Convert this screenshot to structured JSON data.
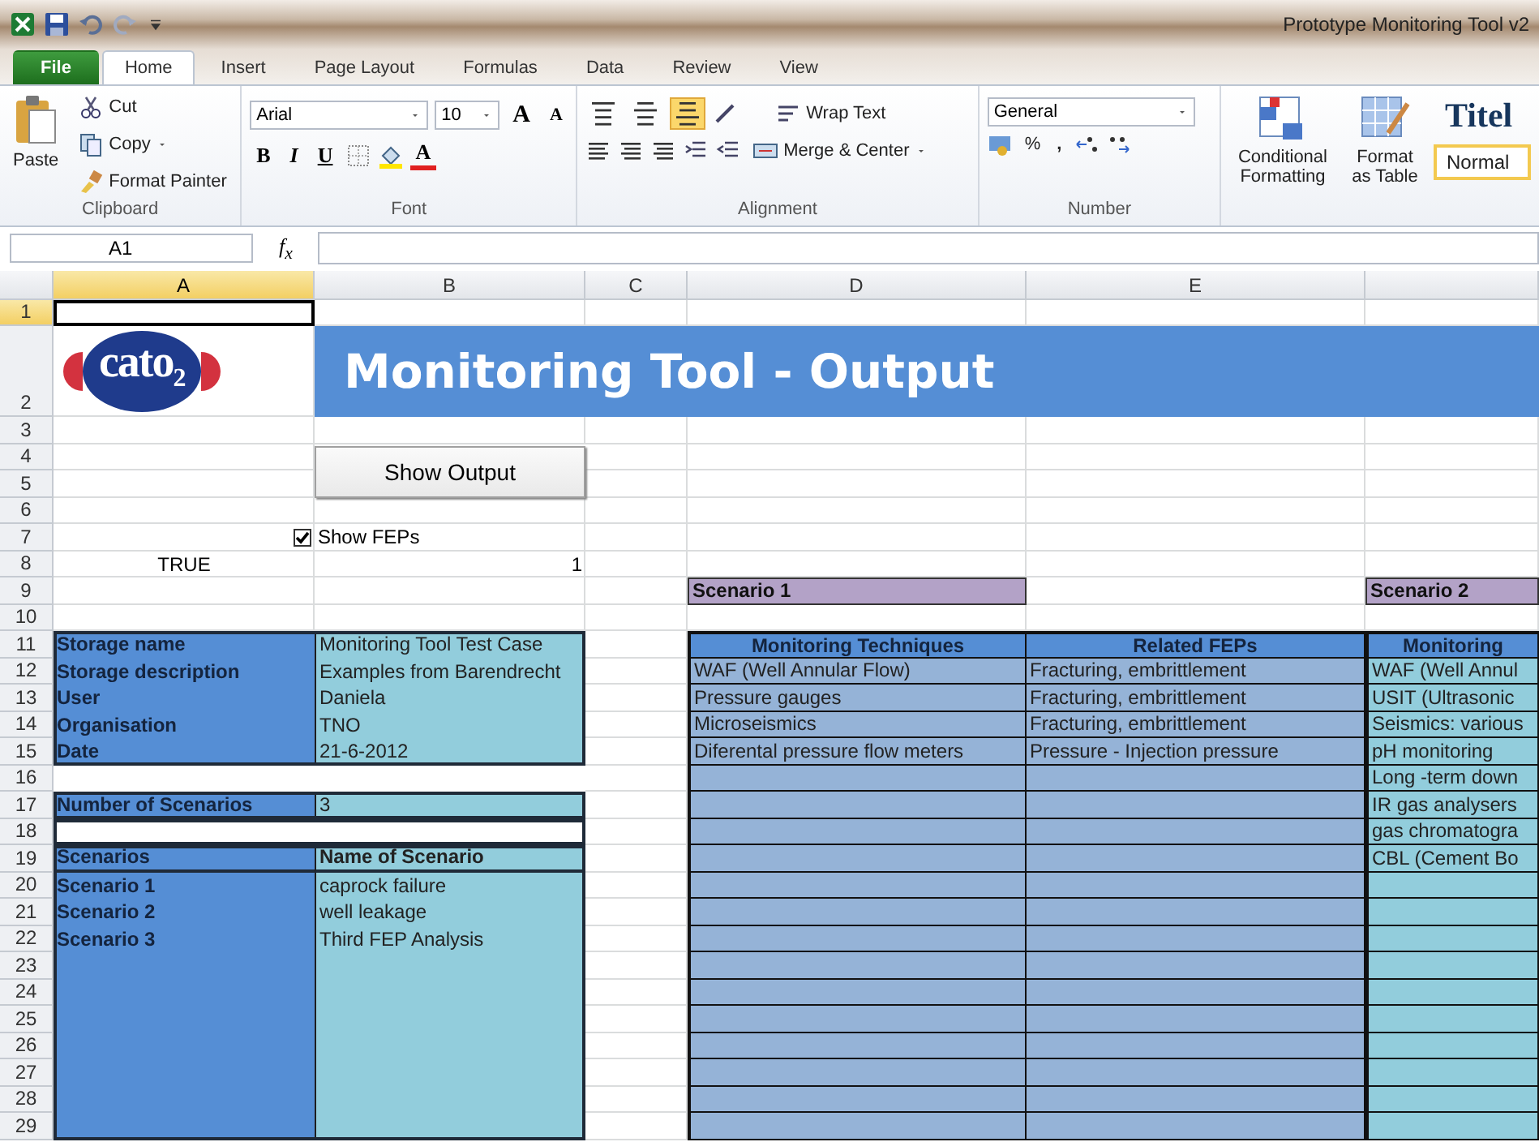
{
  "window": {
    "title": "Prototype Monitoring Tool v2"
  },
  "tabs": [
    {
      "label": "File",
      "kind": "file",
      "selected": false
    },
    {
      "label": "Home",
      "kind": "tab",
      "selected": true
    },
    {
      "label": "Insert",
      "kind": "tab",
      "selected": false
    },
    {
      "label": "Page Layout",
      "kind": "tab",
      "selected": false
    },
    {
      "label": "Formulas",
      "kind": "tab",
      "selected": false
    },
    {
      "label": "Data",
      "kind": "tab",
      "selected": false
    },
    {
      "label": "Review",
      "kind": "tab",
      "selected": false
    },
    {
      "label": "View",
      "kind": "tab",
      "selected": false
    }
  ],
  "ribbon": {
    "clipboard": {
      "label": "Clipboard",
      "paste": "Paste",
      "cut": "Cut",
      "copy": "Copy",
      "format_painter": "Format Painter"
    },
    "font": {
      "label": "Font",
      "font_name": "Arial",
      "font_size": "10",
      "grow": "A",
      "shrink": "A",
      "bold": "B",
      "italic": "I",
      "underline": "U",
      "color_letter": "A"
    },
    "alignment": {
      "label": "Alignment",
      "wrap": "Wrap Text",
      "merge": "Merge & Center",
      "vertical_align": [
        {
          "selected": false
        },
        {
          "selected": false
        },
        {
          "selected": true
        }
      ]
    },
    "number": {
      "label": "Number",
      "format": "General",
      "percent": "%",
      "comma": ","
    },
    "styles": {
      "conditional": "Conditional Formatting",
      "format_table": "Format as Table",
      "style_title": "Titel",
      "style_normal": "Normal"
    }
  },
  "formula_bar": {
    "name_box": "A1",
    "function_button": "f$_{x}$"
  },
  "sheet": {
    "columns": [
      {
        "label": "A",
        "selected": true
      },
      {
        "label": "B",
        "selected": false
      },
      {
        "label": "C",
        "selected": false
      },
      {
        "label": "D",
        "selected": false
      },
      {
        "label": "E",
        "selected": false
      }
    ],
    "rows": [
      {
        "label": "1",
        "selected": true
      },
      {
        "label": "2",
        "selected": false
      },
      {
        "label": "3",
        "selected": false
      },
      {
        "label": "4",
        "selected": false
      },
      {
        "label": "5",
        "selected": false
      },
      {
        "label": "6",
        "selected": false
      },
      {
        "label": "7",
        "selected": false
      },
      {
        "label": "8",
        "selected": false
      },
      {
        "label": "9",
        "selected": false
      },
      {
        "label": "10",
        "selected": false
      },
      {
        "label": "11",
        "selected": false
      },
      {
        "label": "12",
        "selected": false
      },
      {
        "label": "13",
        "selected": false
      },
      {
        "label": "14",
        "selected": false
      },
      {
        "label": "15",
        "selected": false
      },
      {
        "label": "16",
        "selected": false
      },
      {
        "label": "17",
        "selected": false
      },
      {
        "label": "18",
        "selected": false
      },
      {
        "label": "19",
        "selected": false
      },
      {
        "label": "20",
        "selected": false
      },
      {
        "label": "21",
        "selected": false
      },
      {
        "label": "22",
        "selected": false
      },
      {
        "label": "23",
        "selected": false
      },
      {
        "label": "24",
        "selected": false
      },
      {
        "label": "25",
        "selected": false
      },
      {
        "label": "26",
        "selected": false
      },
      {
        "label": "27",
        "selected": false
      },
      {
        "label": "28",
        "selected": false
      },
      {
        "label": "29",
        "selected": false
      }
    ],
    "logo": "cato$_{2}$",
    "banner": "Monitoring Tool - Output",
    "show_output_button": "Show Output",
    "show_feps": {
      "label": "Show FEPs",
      "checked": true
    },
    "flag_value": "TRUE",
    "index_value": "1",
    "storage_info": [
      {
        "label": "Storage name",
        "value": "Monitoring Tool Test Case"
      },
      {
        "label": "Storage description",
        "value": "Examples from Barendrecht"
      },
      {
        "label": "User",
        "value": "Daniela"
      },
      {
        "label": "Organisation",
        "value": "TNO"
      },
      {
        "label": "Date",
        "value": "21-6-2012"
      }
    ],
    "scenario_count": {
      "label": "Number of Scenarios",
      "value": "3"
    },
    "scenarios": {
      "headers": [
        "Scenarios",
        "Name of Scenario"
      ],
      "rows": [
        {
          "label": "Scenario 1",
          "name": "caprock failure"
        },
        {
          "label": "Scenario 2",
          "name": "well leakage"
        },
        {
          "label": "Scenario 3",
          "name": "Third FEP Analysis"
        }
      ]
    },
    "scenario_panels": [
      {
        "title": "Scenario 1",
        "color": "#95b3d7",
        "headers": [
          "Monitoring Techniques",
          "Related FEPs"
        ],
        "rows": [
          [
            "WAF (Well Annular Flow)",
            "Fracturing, embrittlement"
          ],
          [
            "Pressure gauges",
            "Fracturing, embrittlement"
          ],
          [
            "Microseismics",
            "Fracturing, embrittlement"
          ],
          [
            "Diferental pressure flow meters",
            "Pressure - Injection pressure"
          ]
        ]
      },
      {
        "title": "Scenario 2",
        "color": "#92cddc",
        "headers": [
          "Monitoring"
        ],
        "rows": [
          [
            "WAF (Well Annul"
          ],
          [
            "USIT (Ultrasonic"
          ],
          [
            "Seismics: various"
          ],
          [
            "pH monitoring"
          ],
          [
            "Long -term down"
          ],
          [
            "IR gas analysers"
          ],
          [
            "gas chromatogra"
          ],
          [
            "CBL (Cement Bo"
          ]
        ]
      }
    ]
  }
}
